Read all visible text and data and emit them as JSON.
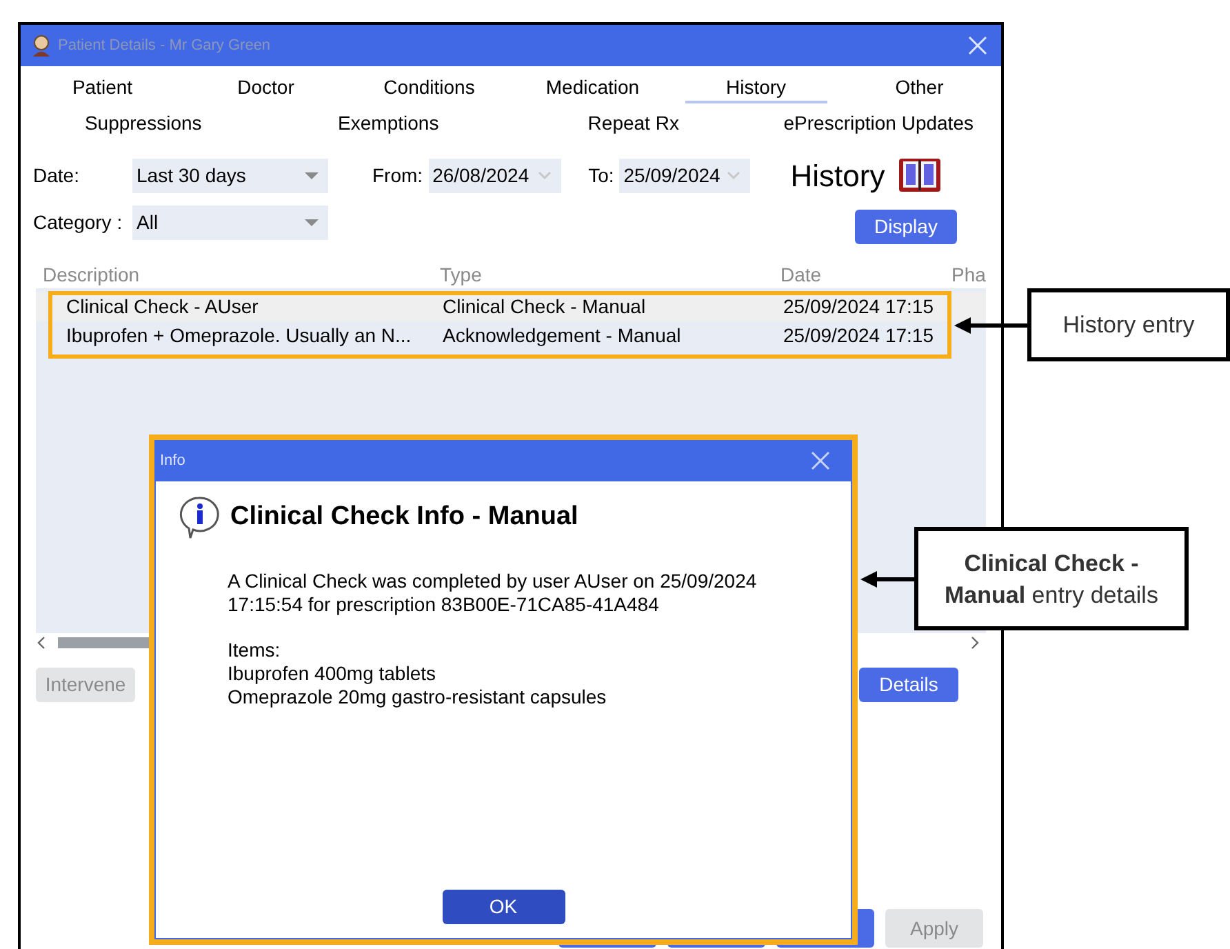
{
  "window": {
    "title": "Patient Details - Mr Gary Green"
  },
  "tabs_row_1": [
    {
      "label": "Patient",
      "selected": false
    },
    {
      "label": "Doctor",
      "selected": false
    },
    {
      "label": "Conditions",
      "selected": false
    },
    {
      "label": "Medication",
      "selected": false
    },
    {
      "label": "History",
      "selected": true
    },
    {
      "label": "Other",
      "selected": false
    }
  ],
  "tabs_row_2": [
    {
      "label": "Suppressions",
      "selected": false
    },
    {
      "label": "Exemptions",
      "selected": false
    },
    {
      "label": "Repeat Rx",
      "selected": false
    },
    {
      "label": "ePrescription Updates",
      "selected": false
    }
  ],
  "filters": {
    "date_label": "Date:",
    "date_value": "Last 30 days",
    "from_label": "From:",
    "from_value": "26/08/2024",
    "to_label": "To:",
    "to_value": "25/09/2024",
    "category_label": "Category :",
    "category_value": "All"
  },
  "section_title": "History",
  "display_button": "Display",
  "table": {
    "columns": [
      "Description",
      "Type",
      "Date",
      "Pha"
    ],
    "rows": [
      {
        "cells": [
          "Clinical Check - AUser",
          "Clinical Check - Manual",
          "25/09/2024 17:15"
        ]
      },
      {
        "cells": [
          "Ibuprofen + Omeprazole. Usually an N...",
          "Acknowledgement - Manual",
          "25/09/2024 17:15"
        ]
      }
    ]
  },
  "actions": [
    {
      "label": "Intervene",
      "disabled": true
    },
    {
      "label": "Details",
      "disabled": false
    }
  ],
  "footer_buttons": [
    {
      "disabled": false
    },
    {
      "disabled": false
    },
    {
      "disabled": false
    },
    {
      "label": "Apply",
      "disabled": true
    }
  ],
  "dialog": {
    "title": "Info",
    "heading": "Clinical Check Info - Manual",
    "message": "A Clinical Check was completed by user AUser on 25/09/2024 17:15:54 for prescription 83B00E-71CA85-41A484",
    "items_label": "Items:",
    "items": [
      "Ibuprofen 400mg tablets",
      "Omeprazole 20mg gastro-resistant capsules"
    ],
    "ok_button": "OK"
  },
  "annotations": [
    {
      "text": "History entry"
    },
    {
      "text": "**Clinical Check - Manual** entry details"
    }
  ]
}
